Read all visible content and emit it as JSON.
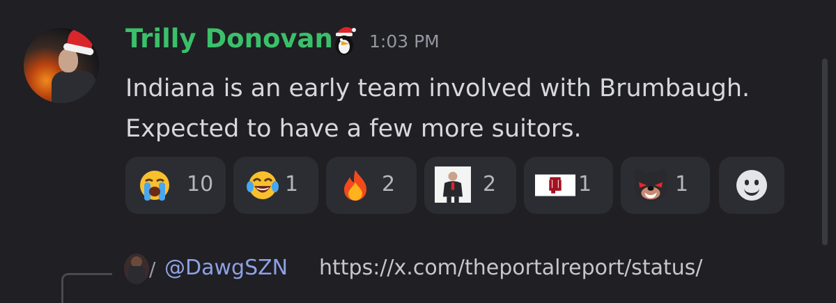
{
  "message": {
    "author": "Trilly Donovan",
    "timestamp": "1:03 PM",
    "lines": [
      "Indiana is an early team involved with Brumbaugh.",
      "Expected to have a few more suitors."
    ]
  },
  "reactions": [
    {
      "icon": "loudly-crying-face-emoji",
      "count": "10"
    },
    {
      "icon": "tears-of-joy-emoji",
      "count": "1"
    },
    {
      "icon": "fire-emoji",
      "count": "2"
    },
    {
      "icon": "coach-photo-emoji",
      "count": "2"
    },
    {
      "icon": "indiana-logo-emoji",
      "count": "1"
    },
    {
      "icon": "bearcat-emoji",
      "count": "1"
    }
  ],
  "add_reaction_icon": "smiley-face-icon",
  "reply": {
    "username": "@DawgSZN",
    "text": "https://x.com/theportalreport/status/"
  },
  "colors": {
    "background": "#1f1f24",
    "author": "#3bc06a",
    "reaction_bg": "#2c2d33",
    "mention": "#8fa1e3"
  }
}
